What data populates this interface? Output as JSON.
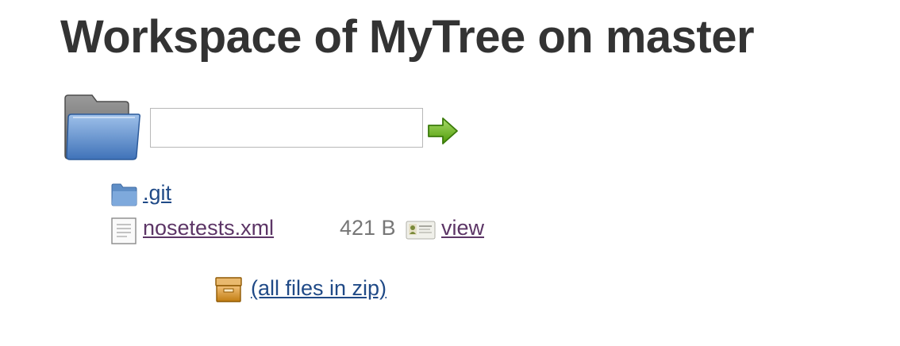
{
  "page": {
    "title": "Workspace of MyTree on master"
  },
  "path_search": {
    "value": "",
    "placeholder": ""
  },
  "files": [
    {
      "name": ".git",
      "type": "folder",
      "icon": "folder-icon"
    },
    {
      "name": "nosetests.xml",
      "type": "file",
      "icon": "document-icon",
      "size": "421 B",
      "view_label": "view"
    }
  ],
  "zip": {
    "label": "(all files in zip)",
    "icon": "package-icon"
  },
  "colors": {
    "link": "#204a87",
    "visited_link": "#5c3566",
    "title": "#333333",
    "size_text": "#777777"
  }
}
